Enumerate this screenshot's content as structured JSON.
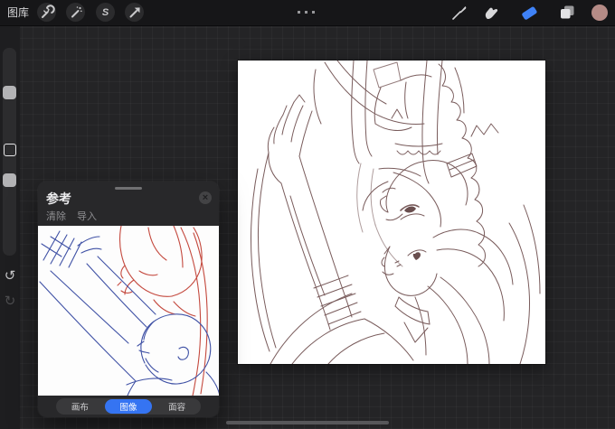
{
  "topbar": {
    "gallery_label": "图库",
    "menu_dots_icon": "ellipsis",
    "tools_left": [
      {
        "name": "actions",
        "icon": "wrench-icon"
      },
      {
        "name": "adjustments",
        "icon": "magic-wand-icon"
      },
      {
        "name": "selection",
        "icon": "s-icon",
        "glyph": "S"
      },
      {
        "name": "transform",
        "icon": "arrow-cursor-icon"
      }
    ],
    "tools_right": [
      {
        "name": "paint",
        "icon": "brush-icon",
        "active": false
      },
      {
        "name": "smudge",
        "icon": "smudge-finger-icon",
        "active": false
      },
      {
        "name": "erase",
        "icon": "eraser-icon",
        "active": true
      },
      {
        "name": "layers",
        "icon": "layers-icon",
        "active": false
      },
      {
        "name": "color",
        "icon": "color-swatch",
        "active": false
      }
    ]
  },
  "sidebar": {
    "undo_glyph": "↺",
    "redo_glyph": "↻",
    "controls": [
      "brush-size-slider",
      "modify-button",
      "opacity-slider"
    ]
  },
  "canvas": {
    "content": "sepia line-art sketch of two anime figures with raised clasped hands, flowing hair and frilled clothing"
  },
  "reference_panel": {
    "title": "参考",
    "actions": [
      {
        "label": "清除"
      },
      {
        "label": "导入"
      }
    ],
    "close_glyph": "×",
    "tabs": [
      {
        "label": "画布",
        "selected": false
      },
      {
        "label": "图像",
        "selected": true
      },
      {
        "label": "面容",
        "selected": false
      }
    ],
    "image_content": "red and blue rough pose sketch: blue figure below reaching up, red figure above upside-down"
  },
  "colors": {
    "accent_blue": "#3574F2",
    "eraser_blue": "#3F82F7",
    "current_color_swatch": "#B58B86",
    "canvas_line": "#6E4E4E",
    "reference_red": "#C4493E",
    "reference_blue": "#3F51A5",
    "topbar_bg": "#161618",
    "panel_bg": "#28282A",
    "workspace_bg": "#242426"
  }
}
